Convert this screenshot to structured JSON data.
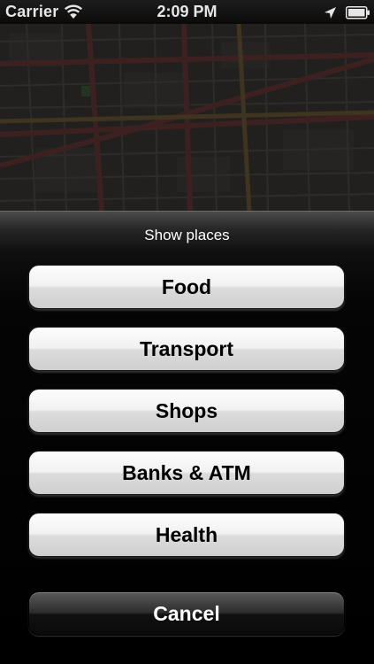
{
  "status_bar": {
    "carrier": "Carrier",
    "time": "2:09 PM",
    "icons": [
      "wifi-icon",
      "location-arrow-icon",
      "battery-icon"
    ]
  },
  "map": {
    "state": "dimmed"
  },
  "action_sheet": {
    "title": "Show places",
    "buttons": [
      {
        "label": "Food"
      },
      {
        "label": "Transport"
      },
      {
        "label": "Shops"
      },
      {
        "label": "Banks & ATM"
      },
      {
        "label": "Health"
      }
    ],
    "cancel_label": "Cancel"
  },
  "colors": {
    "sheet_background": "#000000",
    "button_face": "#ececec",
    "cancel_face": "#1e1e1e",
    "title_text": "#ffffff"
  }
}
